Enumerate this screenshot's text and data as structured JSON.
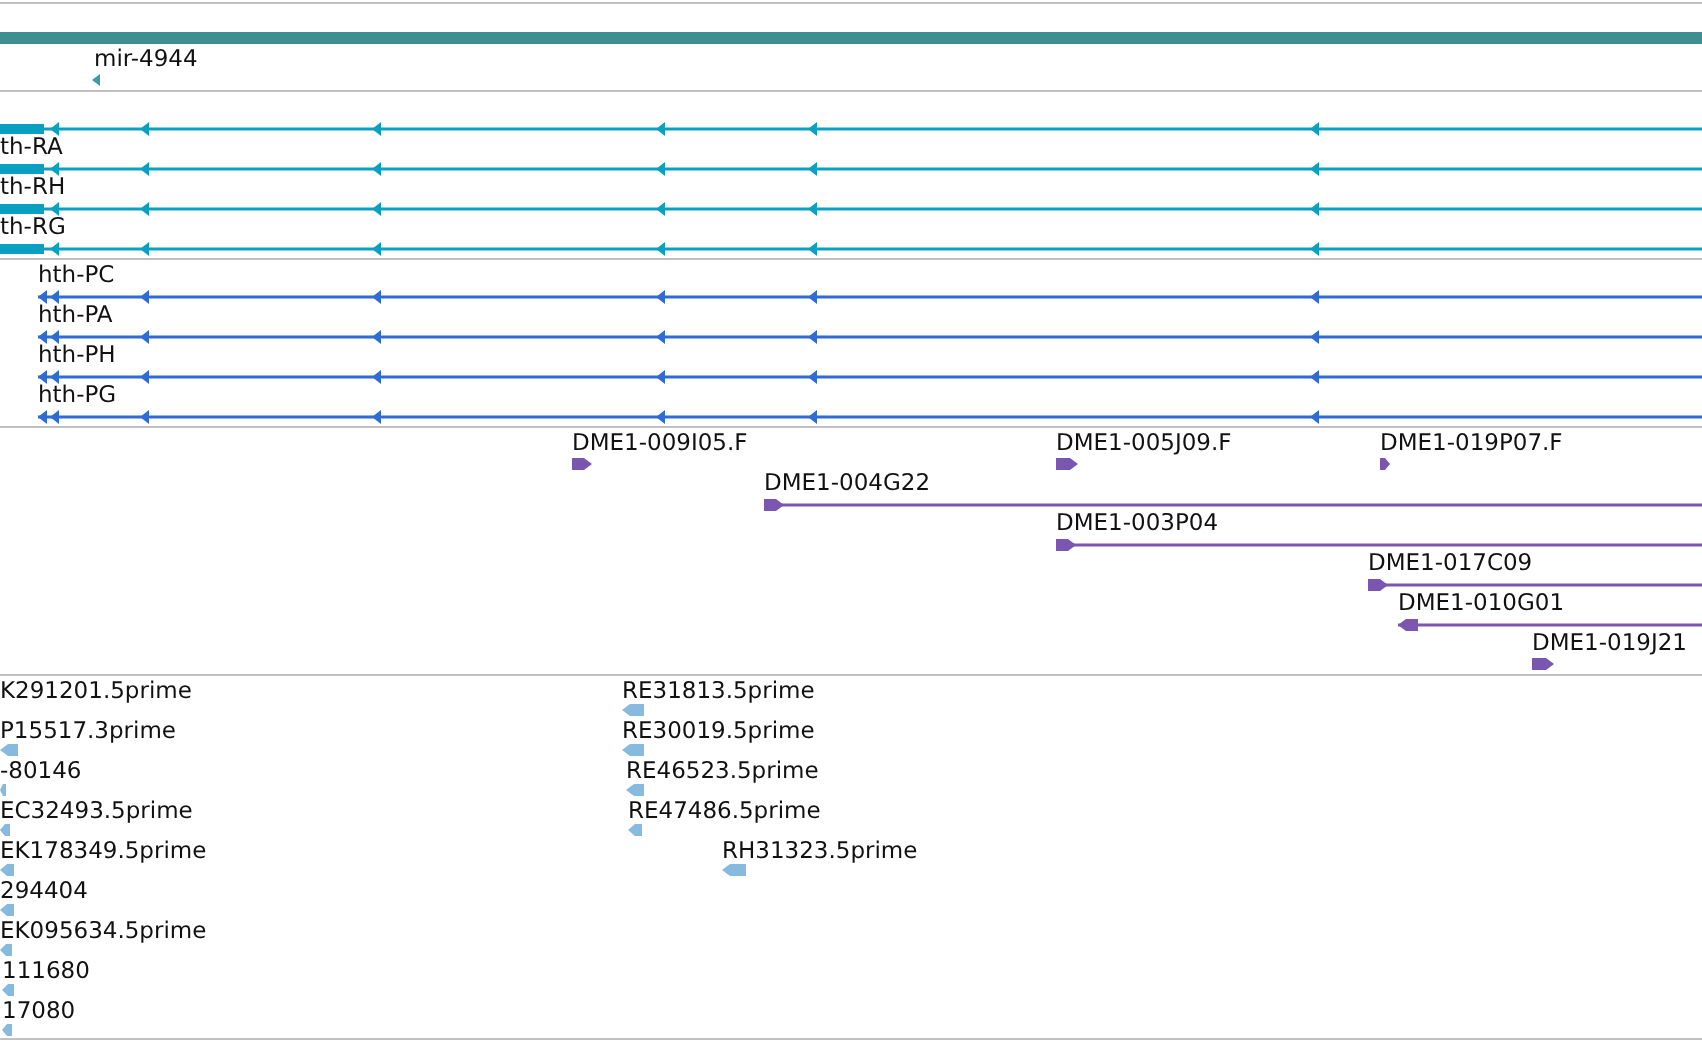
{
  "mirna_track": {
    "features": [
      {
        "label": "mir-4944",
        "reverse_strand": true
      }
    ]
  },
  "transcript_track": {
    "features": [
      {
        "reverse_strand": true
      },
      {
        "label": "th-RA",
        "reverse_strand": true
      },
      {
        "label": "th-RH",
        "reverse_strand": true
      },
      {
        "label": "th-RG",
        "reverse_strand": true
      }
    ]
  },
  "protein_track": {
    "features": [
      {
        "label": "hth-PC",
        "reverse_strand": true
      },
      {
        "label": "hth-PA",
        "reverse_strand": true
      },
      {
        "label": "hth-PH",
        "reverse_strand": true
      },
      {
        "label": "hth-PG",
        "reverse_strand": true
      }
    ]
  },
  "clone_track": {
    "features": [
      {
        "label": "DME1-009I05.F",
        "reverse_strand": false
      },
      {
        "label": "DME1-005J09.F",
        "reverse_strand": false
      },
      {
        "label": "DME1-019P07.F",
        "reverse_strand": false
      },
      {
        "label": "DME1-004G22",
        "reverse_strand": false
      },
      {
        "label": "DME1-003P04",
        "reverse_strand": false
      },
      {
        "label": "DME1-017C09",
        "reverse_strand": false
      },
      {
        "label": "DME1-010G01",
        "reverse_strand": true
      },
      {
        "label": "DME1-019J21",
        "reverse_strand": false
      }
    ]
  },
  "est_track": {
    "features": [
      {
        "label": "K291201.5prime"
      },
      {
        "label": "RE31813.5prime"
      },
      {
        "label": "P15517.3prime"
      },
      {
        "label": "RE30019.5prime"
      },
      {
        "label": "-80146"
      },
      {
        "label": "RE46523.5prime"
      },
      {
        "label": "EC32493.5prime"
      },
      {
        "label": "RE47486.5prime"
      },
      {
        "label": "EK178349.5prime"
      },
      {
        "label": "RH31323.5prime"
      },
      {
        "label": "294404"
      },
      {
        "label": "EK095634.5prime"
      },
      {
        "label": "111680"
      },
      {
        "label": "17080"
      }
    ]
  }
}
